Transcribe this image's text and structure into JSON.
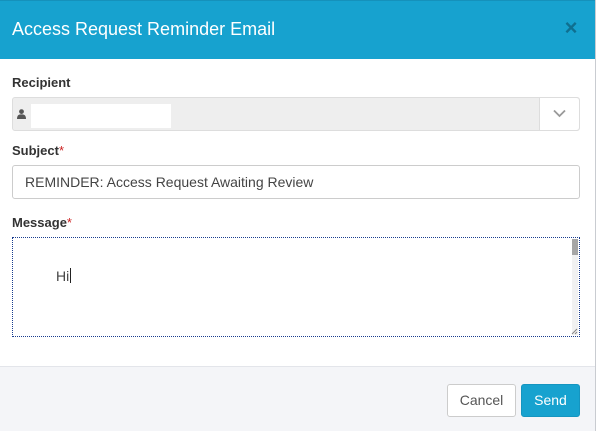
{
  "modal": {
    "title": "Access Request Reminder Email",
    "close_glyph": "×"
  },
  "recipient": {
    "label": "Recipient",
    "icon": "user-icon",
    "value": ""
  },
  "subject": {
    "label": "Subject",
    "required_mark": "*",
    "value": "REMINDER: Access Request Awaiting Review"
  },
  "message": {
    "label": "Message",
    "required_mark": "*",
    "value": "Hi"
  },
  "footer": {
    "cancel_label": "Cancel",
    "send_label": "Send"
  },
  "colors": {
    "accent": "#17a2cf",
    "required": "#cc2222"
  }
}
